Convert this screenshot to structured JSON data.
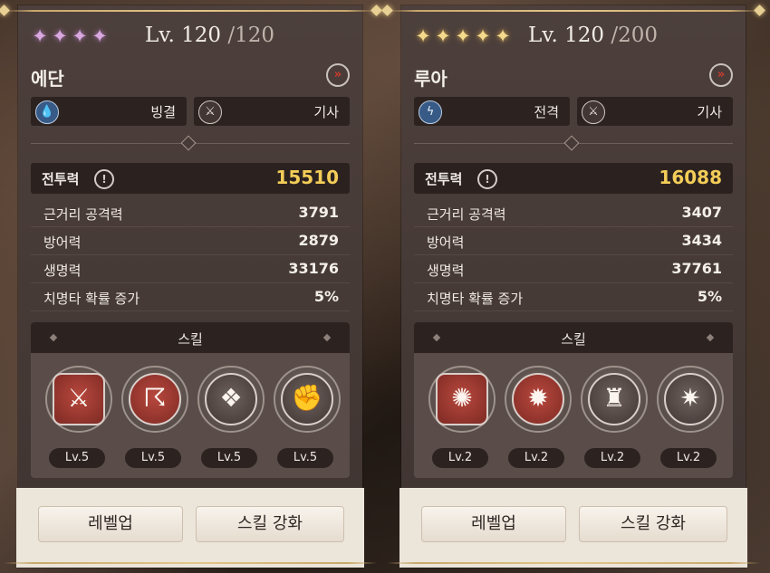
{
  "cards": [
    {
      "stars": [
        "purple",
        "purple",
        "purple",
        "purple"
      ],
      "level_current": "Lv. 120",
      "level_cap": "/120",
      "name": "에단",
      "element_label": "빙결",
      "element_icon": "ice-drop-icon",
      "class_label": "기사",
      "class_icon": "crossed-swords-icon",
      "power_label": "전투력",
      "power_value": "15510",
      "stats": [
        {
          "label": "근거리 공격력",
          "value": "3791"
        },
        {
          "label": "방어력",
          "value": "2879"
        },
        {
          "label": "생명력",
          "value": "33176"
        },
        {
          "label": "치명타 확률 증가",
          "value": "5%"
        }
      ],
      "skill_title": "스킬",
      "skills": [
        {
          "icon": "crossed-swords-icon",
          "level": "Lv.5"
        },
        {
          "icon": "claw-slash-icon",
          "level": "Lv.5"
        },
        {
          "icon": "shield-grid-icon",
          "level": "Lv.5"
        },
        {
          "icon": "fist-icon",
          "level": "Lv.5"
        }
      ],
      "btn_levelup": "레벨업",
      "btn_skill": "스킬 강화"
    },
    {
      "stars": [
        "gold",
        "gold",
        "gold",
        "gold",
        "gold"
      ],
      "level_current": "Lv. 120",
      "level_cap": "/200",
      "name": "루아",
      "element_label": "전격",
      "element_icon": "lightning-icon",
      "class_label": "기사",
      "class_icon": "crossed-swords-icon",
      "power_label": "전투력",
      "power_value": "16088",
      "stats": [
        {
          "label": "근거리 공격력",
          "value": "3407"
        },
        {
          "label": "방어력",
          "value": "3434"
        },
        {
          "label": "생명력",
          "value": "37761"
        },
        {
          "label": "치명타 확률 증가",
          "value": "5%"
        }
      ],
      "skill_title": "스킬",
      "skills": [
        {
          "icon": "vortex-icon",
          "level": "Lv.2"
        },
        {
          "icon": "burst-icon",
          "level": "Lv.2"
        },
        {
          "icon": "aura-figure-icon",
          "level": "Lv.2"
        },
        {
          "icon": "spark-figure-icon",
          "level": "Lv.2"
        }
      ],
      "btn_levelup": "레벨업",
      "btn_skill": "스킬 강화"
    }
  ]
}
